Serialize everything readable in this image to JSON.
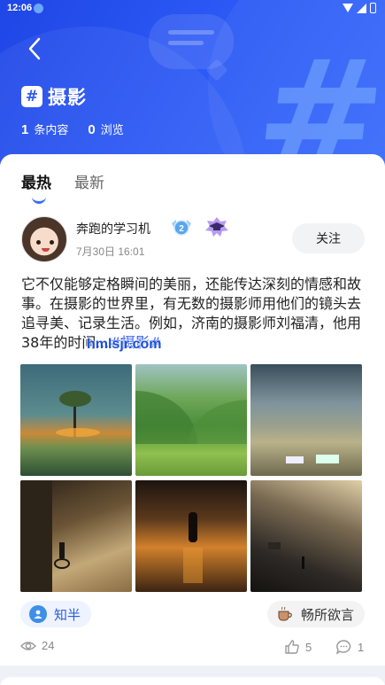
{
  "status_bar": {
    "time": "12:06"
  },
  "header": {
    "topic_badge": "#",
    "topic_title": "摄影",
    "stats": [
      {
        "count": "1",
        "label": "条内容"
      },
      {
        "count": "0",
        "label": "浏览"
      }
    ],
    "accent_color": "#2b58f4"
  },
  "tabs": [
    {
      "label": "最热",
      "active": true
    },
    {
      "label": "最新",
      "active": false
    }
  ],
  "post": {
    "author": {
      "name": "奔跑的学习机",
      "date": "7月30日 16:01",
      "level_badge": "2"
    },
    "follow_label": "关注",
    "text": "它不仅能够定格瞬间的美丽，还能传达深刻的情感和故事。在摄影的世界里，有无数的摄影师用他们的镜头去追寻美、记录生活。例如，济南的摄影师刘福清，他用38年的时间...",
    "hashtag": "#摄影#",
    "watermark": "hmlsjr.com",
    "images": [
      {
        "name": "tree-sunset-photo"
      },
      {
        "name": "green-valley-photo"
      },
      {
        "name": "steppe-caravans-photo"
      },
      {
        "name": "alley-cyclist-photo"
      },
      {
        "name": "rainy-street-walker-photo"
      },
      {
        "name": "city-street-evening-photo"
      }
    ],
    "chips": [
      {
        "label": "知半",
        "icon": "circle-avatar-icon"
      },
      {
        "label": "畅所欲言",
        "icon": "coffee-cup-icon"
      }
    ],
    "views": "24",
    "likes": "5",
    "comments": "1"
  }
}
